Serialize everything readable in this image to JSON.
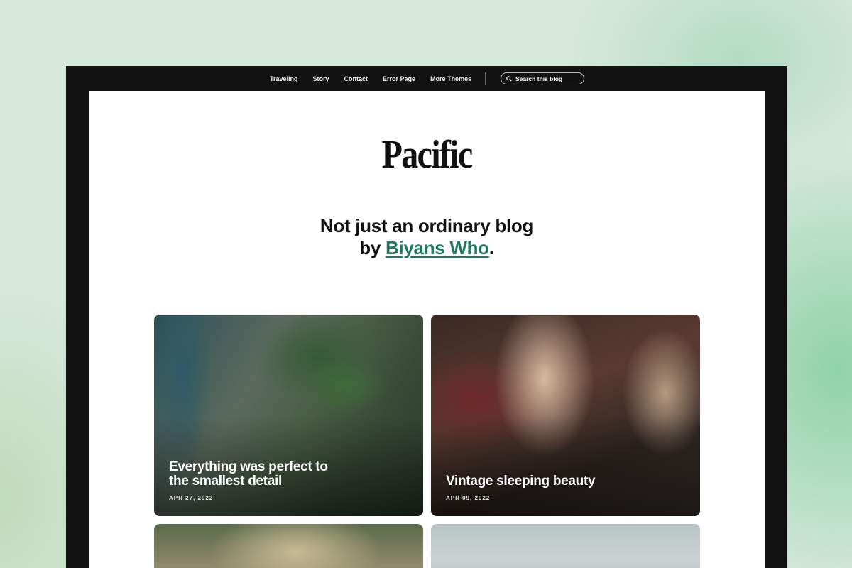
{
  "nav": {
    "items": [
      "Traveling",
      "Story",
      "Contact",
      "Error Page",
      "More Themes"
    ],
    "search_placeholder": "Search this blog"
  },
  "header": {
    "logo": "Pacific",
    "tagline_line1": "Not just an ordinary blog",
    "tagline_by": "by ",
    "author": "Biyans Who",
    "tagline_end": "."
  },
  "posts": [
    {
      "title": "Everything was perfect to the smallest detail",
      "date": "APR 27, 2022"
    },
    {
      "title": "Vintage sleeping beauty",
      "date": "APR 09, 2022"
    }
  ],
  "colors": {
    "accent": "#1f7a5a",
    "frame": "#121212"
  }
}
